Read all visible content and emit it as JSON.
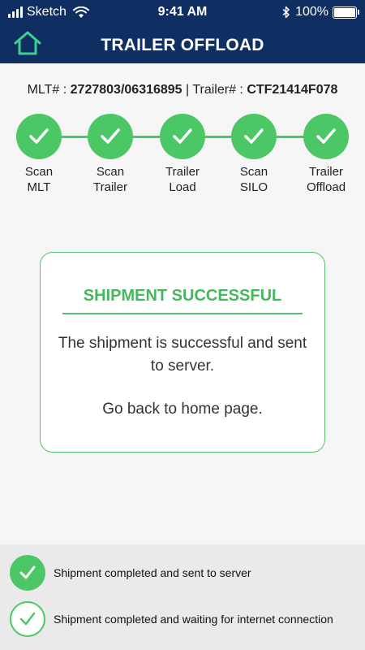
{
  "status_bar": {
    "carrier": "Sketch",
    "time": "9:41 AM",
    "battery": "100%",
    "icons": [
      "signal-icon",
      "wifi-icon",
      "bluetooth-icon",
      "battery-icon"
    ]
  },
  "header": {
    "title": "TRAILER OFFLOAD",
    "home_icon": "home-icon",
    "background": "#0f2f62"
  },
  "info": {
    "mlt_label": "MLT# :",
    "mlt_value": "2727803/06316895",
    "separator": "|",
    "trailer_label": "Trailer# :",
    "trailer_value": "CTF21414F078"
  },
  "steps": [
    {
      "label": "Scan\nMLT",
      "done": true
    },
    {
      "label": "Scan\nTrailer",
      "done": true
    },
    {
      "label": "Trailer\nLoad",
      "done": true
    },
    {
      "label": "Scan\nSILO",
      "done": true
    },
    {
      "label": "Trailer\nOffload",
      "done": true
    }
  ],
  "dialog": {
    "title": "SHIPMENT SUCCESSFUL",
    "message": "The shipment is successful and sent to server.",
    "link": "Go back to home page."
  },
  "legend": [
    {
      "style": "filled",
      "text": "Shipment completed and sent to server"
    },
    {
      "style": "outline",
      "text": "Shipment completed and waiting for internet connection"
    }
  ],
  "colors": {
    "accent_green": "#4cc765",
    "header_blue": "#0f2f62",
    "home_icon_green": "#3fd08e"
  }
}
